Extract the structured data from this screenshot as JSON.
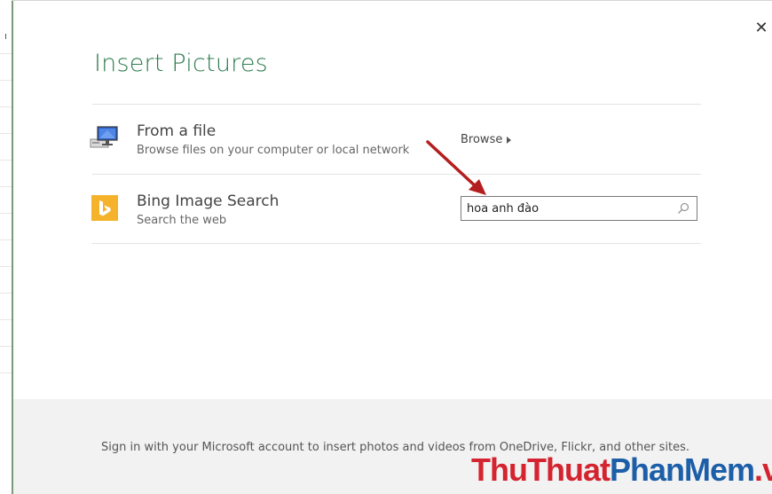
{
  "dialog": {
    "title": "Insert Pictures",
    "close_glyph": "✕"
  },
  "options": [
    {
      "icon": "computer-icon",
      "title": "From a file",
      "subtitle": "Browse files on your computer or local network",
      "action_label": "Browse"
    },
    {
      "icon": "bing-logo-icon",
      "title": "Bing Image Search",
      "subtitle": "Search the web",
      "search_value": "hoa anh đào"
    }
  ],
  "footer": {
    "text": "Sign in with your Microsoft account to insert photos and videos from OneDrive, Flickr, and other sites."
  },
  "watermark": {
    "part1": "ThuThuat",
    "part2": "PhanMem",
    "part3": ".vn"
  },
  "colors": {
    "title": "#2e7d4d",
    "bing": "#f4b32a",
    "arrow": "#b41e1e",
    "watermark_red": "#d3242f",
    "watermark_blue": "#1c5ea8"
  }
}
